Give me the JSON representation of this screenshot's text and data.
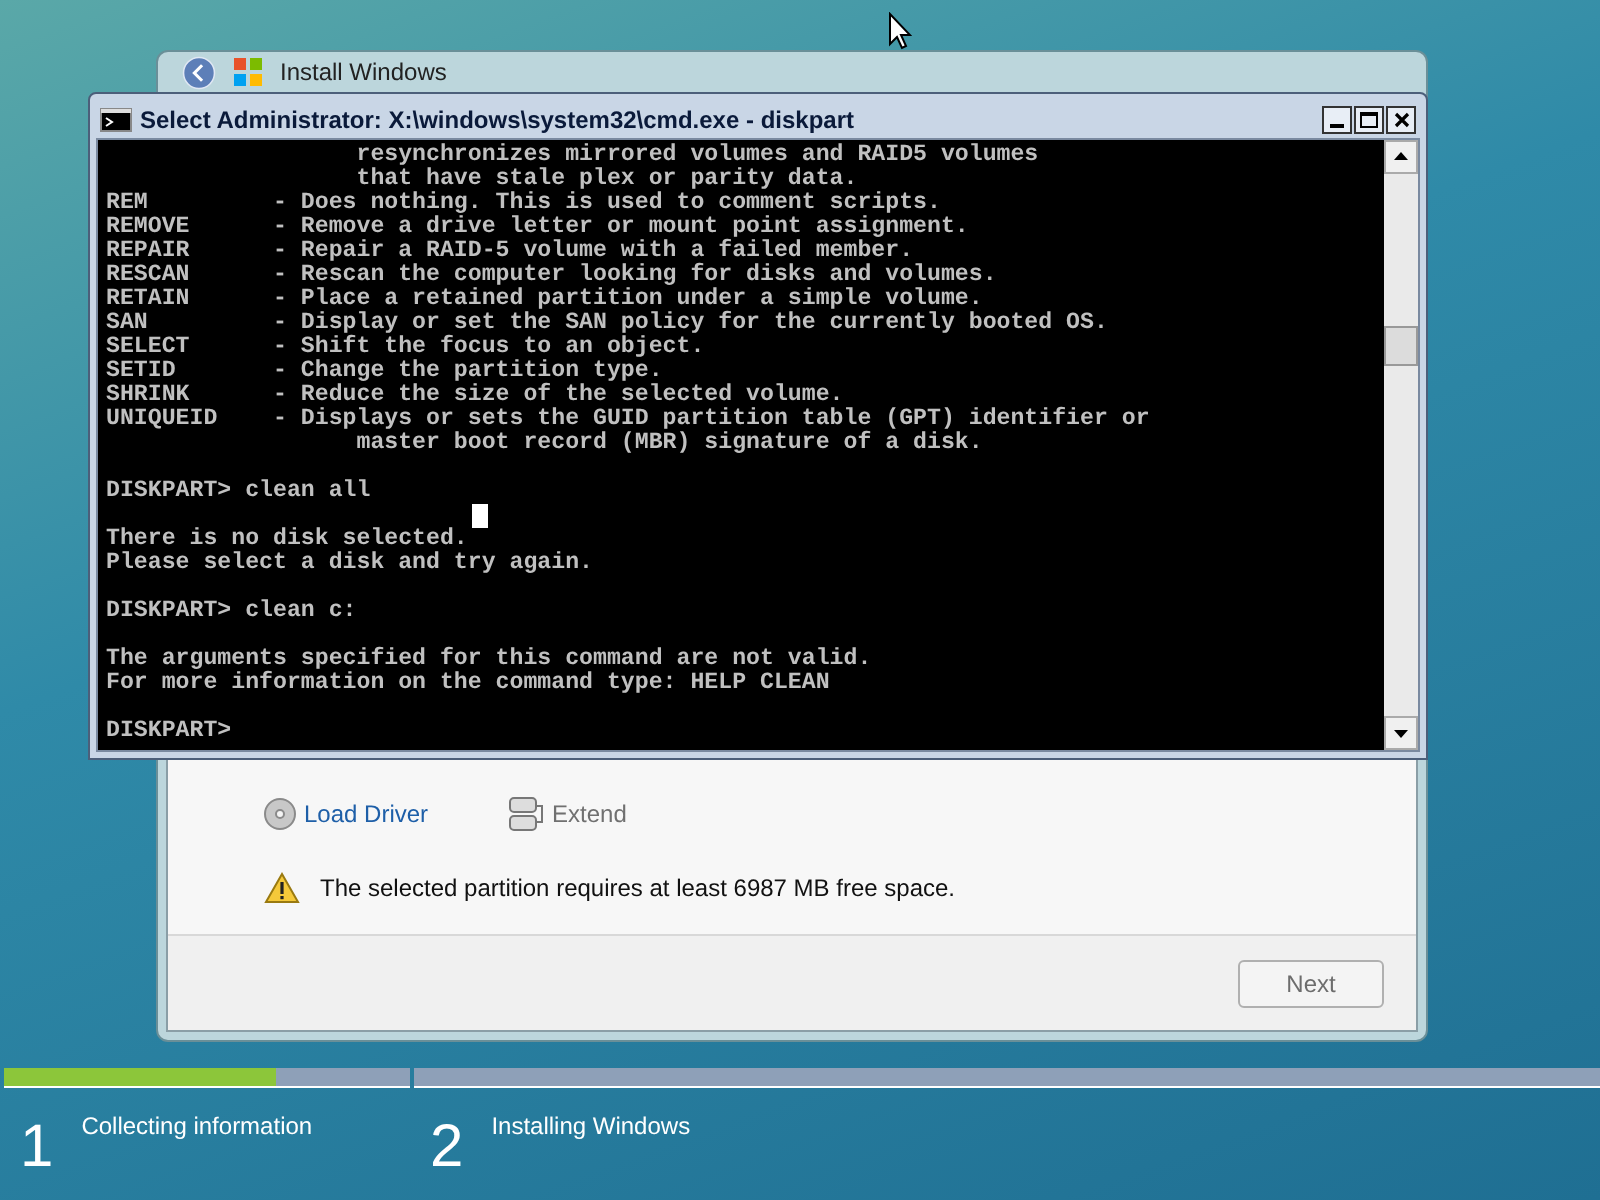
{
  "setup_window": {
    "title": "Install Windows",
    "actions": [
      {
        "label": "Load Driver",
        "disabled": false
      },
      {
        "label": "Extend",
        "disabled": true
      }
    ],
    "warning": "The selected partition requires at least 6987 MB free space.",
    "next_button": {
      "label": "Next",
      "disabled": true
    }
  },
  "console_window": {
    "title": "Select Administrator: X:\\windows\\system32\\cmd.exe - diskpart",
    "blocks": [
      [
        "                  resynchronizes mirrored volumes and RAID5 volumes",
        "                  that have stale plex or parity data.",
        "REM         - Does nothing. This is used to comment scripts.",
        "REMOVE      - Remove a drive letter or mount point assignment.",
        "REPAIR      - Repair a RAID-5 volume with a failed member.",
        "RESCAN      - Rescan the computer looking for disks and volumes.",
        "RETAIN      - Place a retained partition under a simple volume.",
        "SAN         - Display or set the SAN policy for the currently booted OS.",
        "SELECT      - Shift the focus to an object.",
        "SETID       - Change the partition type.",
        "SHRINK      - Reduce the size of the selected volume.",
        "UNIQUEID    - Displays or sets the GUID partition table (GPT) identifier or",
        "                  master boot record (MBR) signature of a disk."
      ],
      [
        "DISKPART> clean all"
      ],
      [
        "There is no disk selected.",
        "Please select a disk and try again."
      ],
      [
        "DISKPART> clean c:"
      ],
      [
        "The arguments specified for this command are not valid.",
        "For more information on the command type: HELP CLEAN"
      ],
      [
        "DISKPART>"
      ]
    ]
  },
  "steps": [
    {
      "number": "1",
      "label": "Collecting information",
      "level": 0.67
    },
    {
      "number": "2",
      "label": "Installing Windows"
    }
  ]
}
